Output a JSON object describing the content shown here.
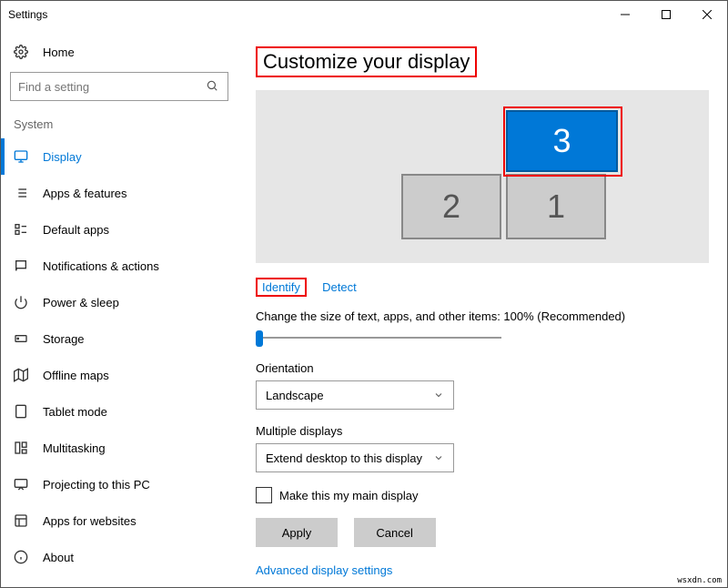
{
  "window": {
    "title": "Settings"
  },
  "sidebar": {
    "home": "Home",
    "search_placeholder": "Find a setting",
    "group": "System",
    "items": [
      {
        "label": "Display"
      },
      {
        "label": "Apps & features"
      },
      {
        "label": "Default apps"
      },
      {
        "label": "Notifications & actions"
      },
      {
        "label": "Power & sleep"
      },
      {
        "label": "Storage"
      },
      {
        "label": "Offline maps"
      },
      {
        "label": "Tablet mode"
      },
      {
        "label": "Multitasking"
      },
      {
        "label": "Projecting to this PC"
      },
      {
        "label": "Apps for websites"
      },
      {
        "label": "About"
      }
    ]
  },
  "main": {
    "title": "Customize your display",
    "monitors": {
      "m1": "1",
      "m2": "2",
      "m3": "3"
    },
    "identify": "Identify",
    "detect": "Detect",
    "scale_label": "Change the size of text, apps, and other items: 100% (Recommended)",
    "orientation_label": "Orientation",
    "orientation_value": "Landscape",
    "multiple_label": "Multiple displays",
    "multiple_value": "Extend desktop to this display",
    "main_display_checkbox": "Make this my main display",
    "apply": "Apply",
    "cancel": "Cancel",
    "advanced": "Advanced display settings"
  },
  "watermark": "wsxdn.com"
}
